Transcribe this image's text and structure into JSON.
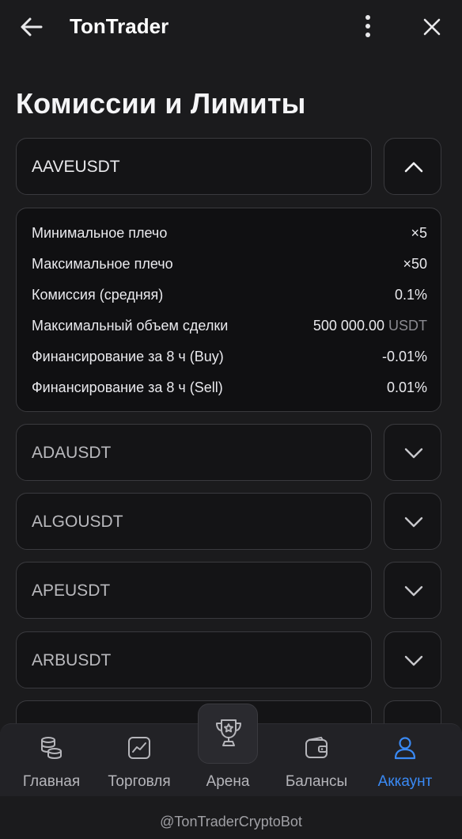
{
  "header": {
    "title": "TonTrader"
  },
  "page": {
    "title": "Комиссии и Лимиты"
  },
  "expanded": {
    "symbol": "AAVEUSDT",
    "rows": [
      {
        "label": "Минимальное плечо",
        "value": "×5",
        "unit": ""
      },
      {
        "label": "Максимальное плечо",
        "value": "×50",
        "unit": ""
      },
      {
        "label": "Комиссия (средняя)",
        "value": "0.1%",
        "unit": ""
      },
      {
        "label": "Максимальный объем сделки",
        "value": "500 000.00",
        "unit": "USDT"
      },
      {
        "label": "Финансирование за 8 ч (Buy)",
        "value": "-0.01%",
        "unit": ""
      },
      {
        "label": "Финансирование за 8 ч (Sell)",
        "value": "0.01%",
        "unit": ""
      }
    ]
  },
  "symbols": [
    "ADAUSDT",
    "ALGOUSDT",
    "APEUSDT",
    "ARBUSDT"
  ],
  "nav": {
    "items": [
      {
        "label": "Главная",
        "icon": "coins-icon"
      },
      {
        "label": "Торговля",
        "icon": "chart-icon"
      },
      {
        "label": "Арена",
        "icon": "trophy-icon"
      },
      {
        "label": "Балансы",
        "icon": "wallet-icon"
      },
      {
        "label": "Аккаунт",
        "icon": "user-icon"
      }
    ],
    "active": "Аккаунт"
  },
  "footer": {
    "handle": "@TonTraderCryptoBot"
  },
  "colors": {
    "background": "#1b1b1d",
    "accent": "#3a8af5",
    "border": "#3a3a3e"
  }
}
